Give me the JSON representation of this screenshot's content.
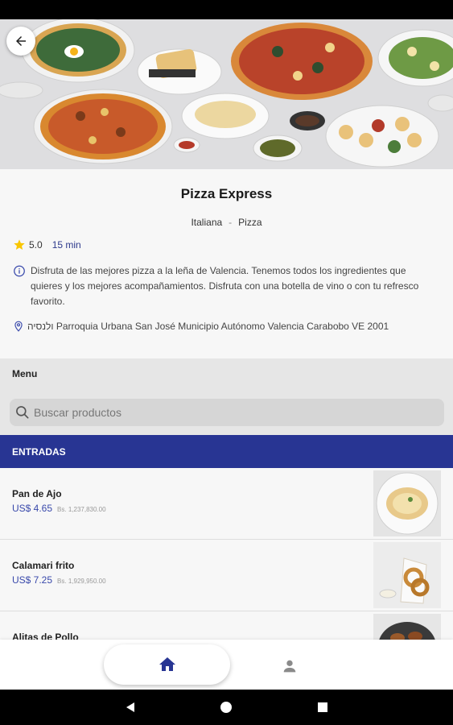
{
  "restaurant": {
    "name": "Pizza Express",
    "categories": [
      "Italiana",
      "Pizza"
    ],
    "category_separator": "-",
    "rating": "5.0",
    "delivery_time": "15 min",
    "description": "Disfruta de las mejores pizza a la leña de Valencia. Tenemos todos los ingredientes que quieres y los mejores acompañamientos. Disfruta con una botella de vino o con tu refresco favorito.",
    "address": "ולנסיה Parroquia Urbana San José Municipio Autónomo Valencia Carabobo VE 2001"
  },
  "menu": {
    "title": "Menu",
    "search_placeholder": "Buscar productos"
  },
  "category": {
    "name": "ENTRADAS"
  },
  "products": [
    {
      "name": "Pan de Ajo",
      "price_usd": "US$ 4.65",
      "price_bs": "Bs. 1,237,830.00"
    },
    {
      "name": "Calamari frito",
      "price_usd": "US$ 7.25",
      "price_bs": "Bs. 1,929,950.00"
    },
    {
      "name": "Alitas de Pollo",
      "price_usd": "",
      "price_bs": ""
    }
  ],
  "colors": {
    "accent": "#283593",
    "price": "#3949ab",
    "star": "#f9c600"
  },
  "icons": {
    "back": "arrow-left-icon",
    "star": "star-icon",
    "info": "info-icon",
    "location": "location-pin-icon",
    "search": "search-icon",
    "home": "home-icon",
    "profile": "person-icon"
  }
}
